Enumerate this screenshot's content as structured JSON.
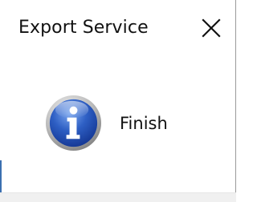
{
  "window": {
    "title": "Export Service"
  },
  "message": {
    "text": "Finish"
  },
  "icons": {
    "info": "info-icon",
    "close": "close-icon"
  },
  "colors": {
    "background": "#ffffff",
    "footer": "#f0f0f0",
    "info_blue": "#2a56b8",
    "text": "#111111"
  }
}
